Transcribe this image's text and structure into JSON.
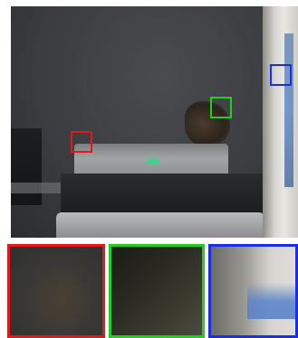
{
  "figure": {
    "main_image": {
      "subject": "office-printer-scene"
    },
    "zoom_regions": [
      {
        "id": "red",
        "color": "#e01a1a"
      },
      {
        "id": "green",
        "color": "#1fd11f"
      },
      {
        "id": "blue",
        "color": "#1a2fe0"
      }
    ],
    "colors": {
      "red_box": "#e01a1a",
      "green_box": "#1fd11f",
      "blue_box": "#1a2fe0"
    }
  }
}
